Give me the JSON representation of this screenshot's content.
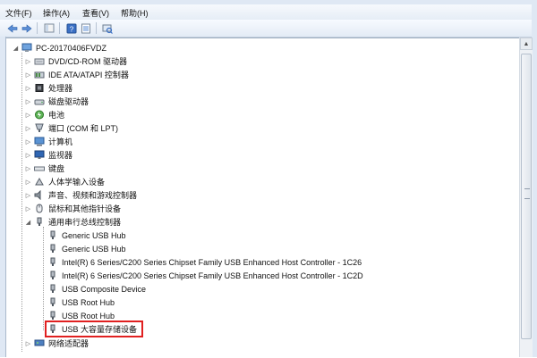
{
  "menu": [
    {
      "label": "文件(F)"
    },
    {
      "label": "操作(A)"
    },
    {
      "label": "查看(V)"
    },
    {
      "label": "帮助(H)"
    }
  ],
  "toolbar": {
    "buttons": [
      "back-icon",
      "forward-icon",
      "device-icon",
      "help-icon",
      "properties-icon",
      "scan-icon"
    ]
  },
  "tree": {
    "root": "PC-20170406FVDZ",
    "categories": [
      {
        "label": "DVD/CD-ROM 驱动器",
        "icon": "dvd-drive-icon"
      },
      {
        "label": "IDE ATA/ATAPI 控制器",
        "icon": "ide-controller-icon"
      },
      {
        "label": "处理器",
        "icon": "processor-icon"
      },
      {
        "label": "磁盘驱动器",
        "icon": "disk-drive-icon"
      },
      {
        "label": "电池",
        "icon": "battery-icon"
      },
      {
        "label": "端口 (COM 和 LPT)",
        "icon": "port-icon"
      },
      {
        "label": "计算机",
        "icon": "computer-icon"
      },
      {
        "label": "监视器",
        "icon": "monitor-icon"
      },
      {
        "label": "键盘",
        "icon": "keyboard-icon"
      },
      {
        "label": "人体学输入设备",
        "icon": "hid-icon"
      },
      {
        "label": "声音、视频和游戏控制器",
        "icon": "sound-icon"
      },
      {
        "label": "鼠标和其他指针设备",
        "icon": "mouse-icon"
      },
      {
        "label": "通用串行总线控制器",
        "icon": "usb-controller-icon"
      }
    ],
    "usb_children": [
      "Generic USB Hub",
      "Generic USB Hub",
      "Intel(R) 6 Series/C200 Series Chipset Family USB Enhanced Host Controller - 1C26",
      "Intel(R) 6 Series/C200 Series Chipset Family USB Enhanced Host Controller - 1C2D",
      "USB Composite Device",
      "USB Root Hub",
      "USB Root Hub",
      "USB 大容量存储设备"
    ],
    "last_category": {
      "label": "网络适配器",
      "icon": "network-adapter-icon"
    }
  },
  "colors": {
    "highlight": "#e02020",
    "accent": "#2a66b8"
  }
}
